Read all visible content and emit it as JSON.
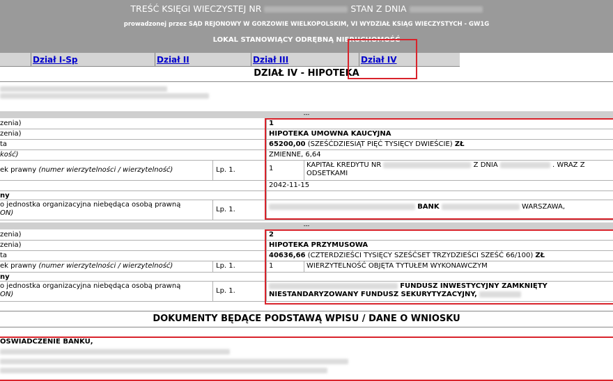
{
  "header": {
    "line1_prefix": "TREŚĆ KSIĘGI WIECZYSTEJ NR",
    "line1_mid": "STAN Z DNIA",
    "line2": "prowadzonej przez SĄD REJONOWY W GORZOWIE WIELKOPOLSKIM, VI WYDZIAŁ KSIĄG WIECZYSTYCH - GW1G",
    "line3": "LOKAL STANOWIĄCY ODRĘBNĄ NIERUCHOMOŚĆ"
  },
  "tabs": [
    "Dział I-Sp",
    "Dział II",
    "Dział III",
    "Dział IV"
  ],
  "section_title": "DZIAŁ IV - HIPOTEKA",
  "separator": "---",
  "labels": {
    "nr_wpisu": "zenia)",
    "rodzaj": "zenia)",
    "suma": "ta",
    "odsetki": "kość)",
    "wierz_prefix": "ek prawny",
    "wierz_italic": "(numer wierzytelności / wierzytelność)",
    "wierzyciel": "ny",
    "osoba_line1": "o jednostka organizacyjna niebędąca osobą prawną",
    "osoba_line2": "ON)"
  },
  "lp": "Lp. 1.",
  "mortgage1": {
    "number": "1",
    "type": "HIPOTEKA UMOWNA KAUCYJNA",
    "amount": "65200,00",
    "amount_words": "(SZEŚĆDZIESIĄT PIĘĆ TYSIĘCY DWIEŚCIE)",
    "currency": "ZŁ",
    "interest": "ZMIENNE, 6,64",
    "claim_lp": "1",
    "claim_part1": "KAPITAŁ KREDYTU NR",
    "claim_part2": "Z DNIA",
    "claim_part3": ". WRAZ Z",
    "claim_line2": "ODSETKAMI",
    "date": "2042-11-15",
    "creditor_bank": "BANK",
    "creditor_city": "WARSZAWA,"
  },
  "mortgage2": {
    "number": "2",
    "type": "HIPOTEKA PRZYMUSOWA",
    "amount": "40636,66",
    "amount_words": "(CZTERDZIEŚCI TYSIĘCY SZEŚĆSET TRZYDZIEŚCI SZEŚĆ 66/100)",
    "currency": "ZŁ",
    "claim_lp": "1",
    "claim": "WIERZYTELNOŚĆ OBJĘTA TYTUŁEM WYKONAWCZYM",
    "creditor_line1": "FUNDUSZ INWESTYCYJNY ZAMKNIĘTY",
    "creditor_line2": "NIESTANDARYZOWANY FUNDUSZ SEKURYTYZACYJNY,"
  },
  "docs_title": "DOKUMENTY BĘDĄCE PODSTAWĄ WPISU / DANE O WNIOSKU",
  "docs_first": "OŚWIADCZENIE BANKU,",
  "colors": {
    "header_bg": "#9a9a9a",
    "link": "#0000cc",
    "highlight": "#d9232b"
  }
}
